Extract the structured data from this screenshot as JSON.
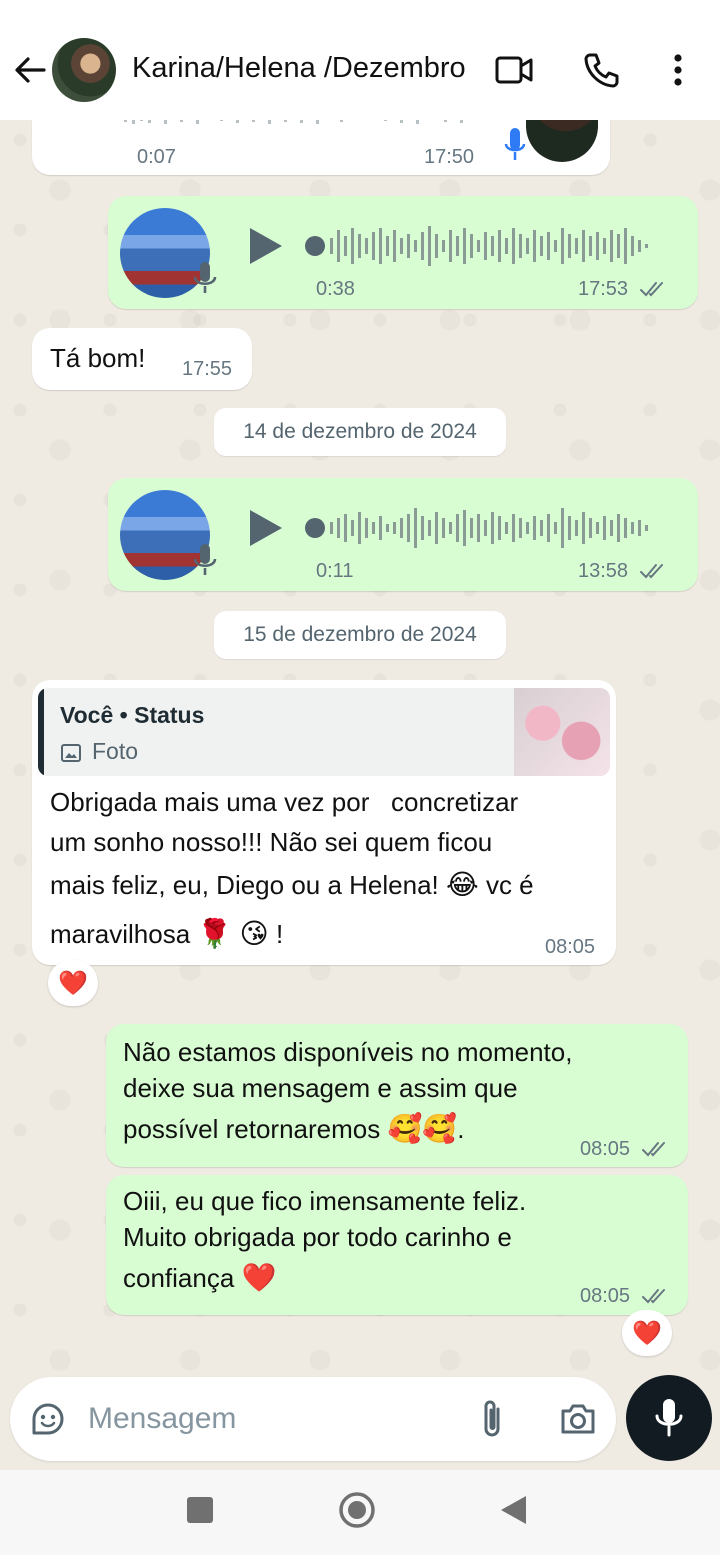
{
  "header": {
    "title": "Karina/Helena /Dezembro",
    "icons": [
      "back-arrow-icon",
      "video-call-icon",
      "phone-icon",
      "more-vert-icon"
    ]
  },
  "messages": {
    "voice0": {
      "duration": "0:07",
      "time": "17:50",
      "direction": "incoming"
    },
    "voice1": {
      "duration": "0:38",
      "time": "17:53",
      "direction": "outgoing",
      "status": "read"
    },
    "text1": {
      "text": "Tá bom!",
      "time": "17:55",
      "direction": "incoming"
    },
    "date1": "14 de dezembro de 2024",
    "voice2": {
      "duration": "0:11",
      "time": "13:58",
      "direction": "outgoing",
      "status": "read"
    },
    "date2": "15 de dezembro de 2024",
    "reply": {
      "quote_author": "Você • Status",
      "quote_type": "Foto",
      "line1": "Obrigada mais uma vez por   concretizar",
      "line2": "um sonho nosso!!! Não sei quem ficou",
      "line3": "mais feliz, eu, Diego ou a Helena!",
      "line3_emoji": "😂",
      "line3_end": " vc é",
      "line4": "maravilhosa",
      "line4_emoji1": "🌹",
      "line4_emoji2": "😘",
      "line4_end": " !",
      "time": "08:05",
      "reaction": "❤️"
    },
    "auto": {
      "line1": "Não estamos disponíveis no momento,",
      "line2": "deixe sua mensagem e assim que",
      "line3": "possível retornaremos",
      "line3_emoji": "🥰🥰",
      "line3_end": ".",
      "time": "08:05",
      "status": "read"
    },
    "thanks": {
      "line1": "Oiii, eu que fico imensamente feliz.",
      "line2": "Muito obrigada por todo carinho e",
      "line3": "confiança",
      "line3_emoji": "❤️",
      "time": "08:05",
      "status": "read",
      "reaction": "❤️"
    }
  },
  "input": {
    "placeholder": "Mensagem",
    "icons": [
      "sticker-icon",
      "attach-icon",
      "camera-icon",
      "mic-icon"
    ]
  },
  "colors": {
    "outgoing_bubble": "#d9fdd3",
    "incoming_bubble": "#ffffff",
    "chat_bg": "#efeae2",
    "tick_color": "#667781",
    "mic_accent": "#2f7bf5"
  }
}
